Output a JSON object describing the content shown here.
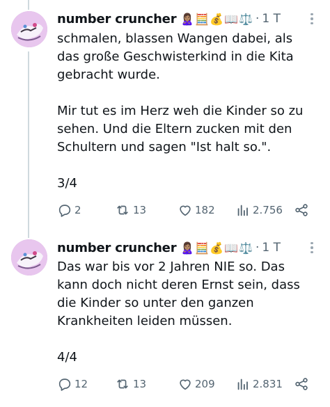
{
  "tweets": [
    {
      "author": "number cruncher",
      "emojis": "🙎🏽‍♀️🧮💰📖⚖️",
      "time": "1 T",
      "lines": [
        "schmalen, blassen Wangen dabei, als",
        "das große Geschwisterkind in die Kita",
        "gebracht wurde.",
        "",
        "Mir tut es im Herz weh die Kinder so zu",
        "sehen. Und die Eltern zucken mit den",
        "Schultern und sagen \"Ist halt so.\".",
        "",
        "3/4"
      ],
      "stats": {
        "replies": "2",
        "retweets": "13",
        "likes": "182",
        "views": "2.756"
      }
    },
    {
      "author": "number cruncher",
      "emojis": "🙎🏽‍♀️🧮💰📖⚖️",
      "time": "1 T",
      "lines": [
        "Das war bis vor 2 Jahren NIE so. Das",
        "kann doch nicht deren Ernst sein, dass",
        "die Kinder so unter den ganzen",
        "Krankheiten leiden müssen.",
        "",
        "4/4"
      ],
      "stats": {
        "replies": "12",
        "retweets": "13",
        "likes": "209",
        "views": "2.831"
      }
    }
  ],
  "colors": {
    "text": "#0f1419",
    "muted": "#536471",
    "thread_line": "#cfd9de"
  },
  "icons": [
    "reply-icon",
    "retweet-icon",
    "like-icon",
    "views-icon",
    "share-icon",
    "more-icon"
  ]
}
